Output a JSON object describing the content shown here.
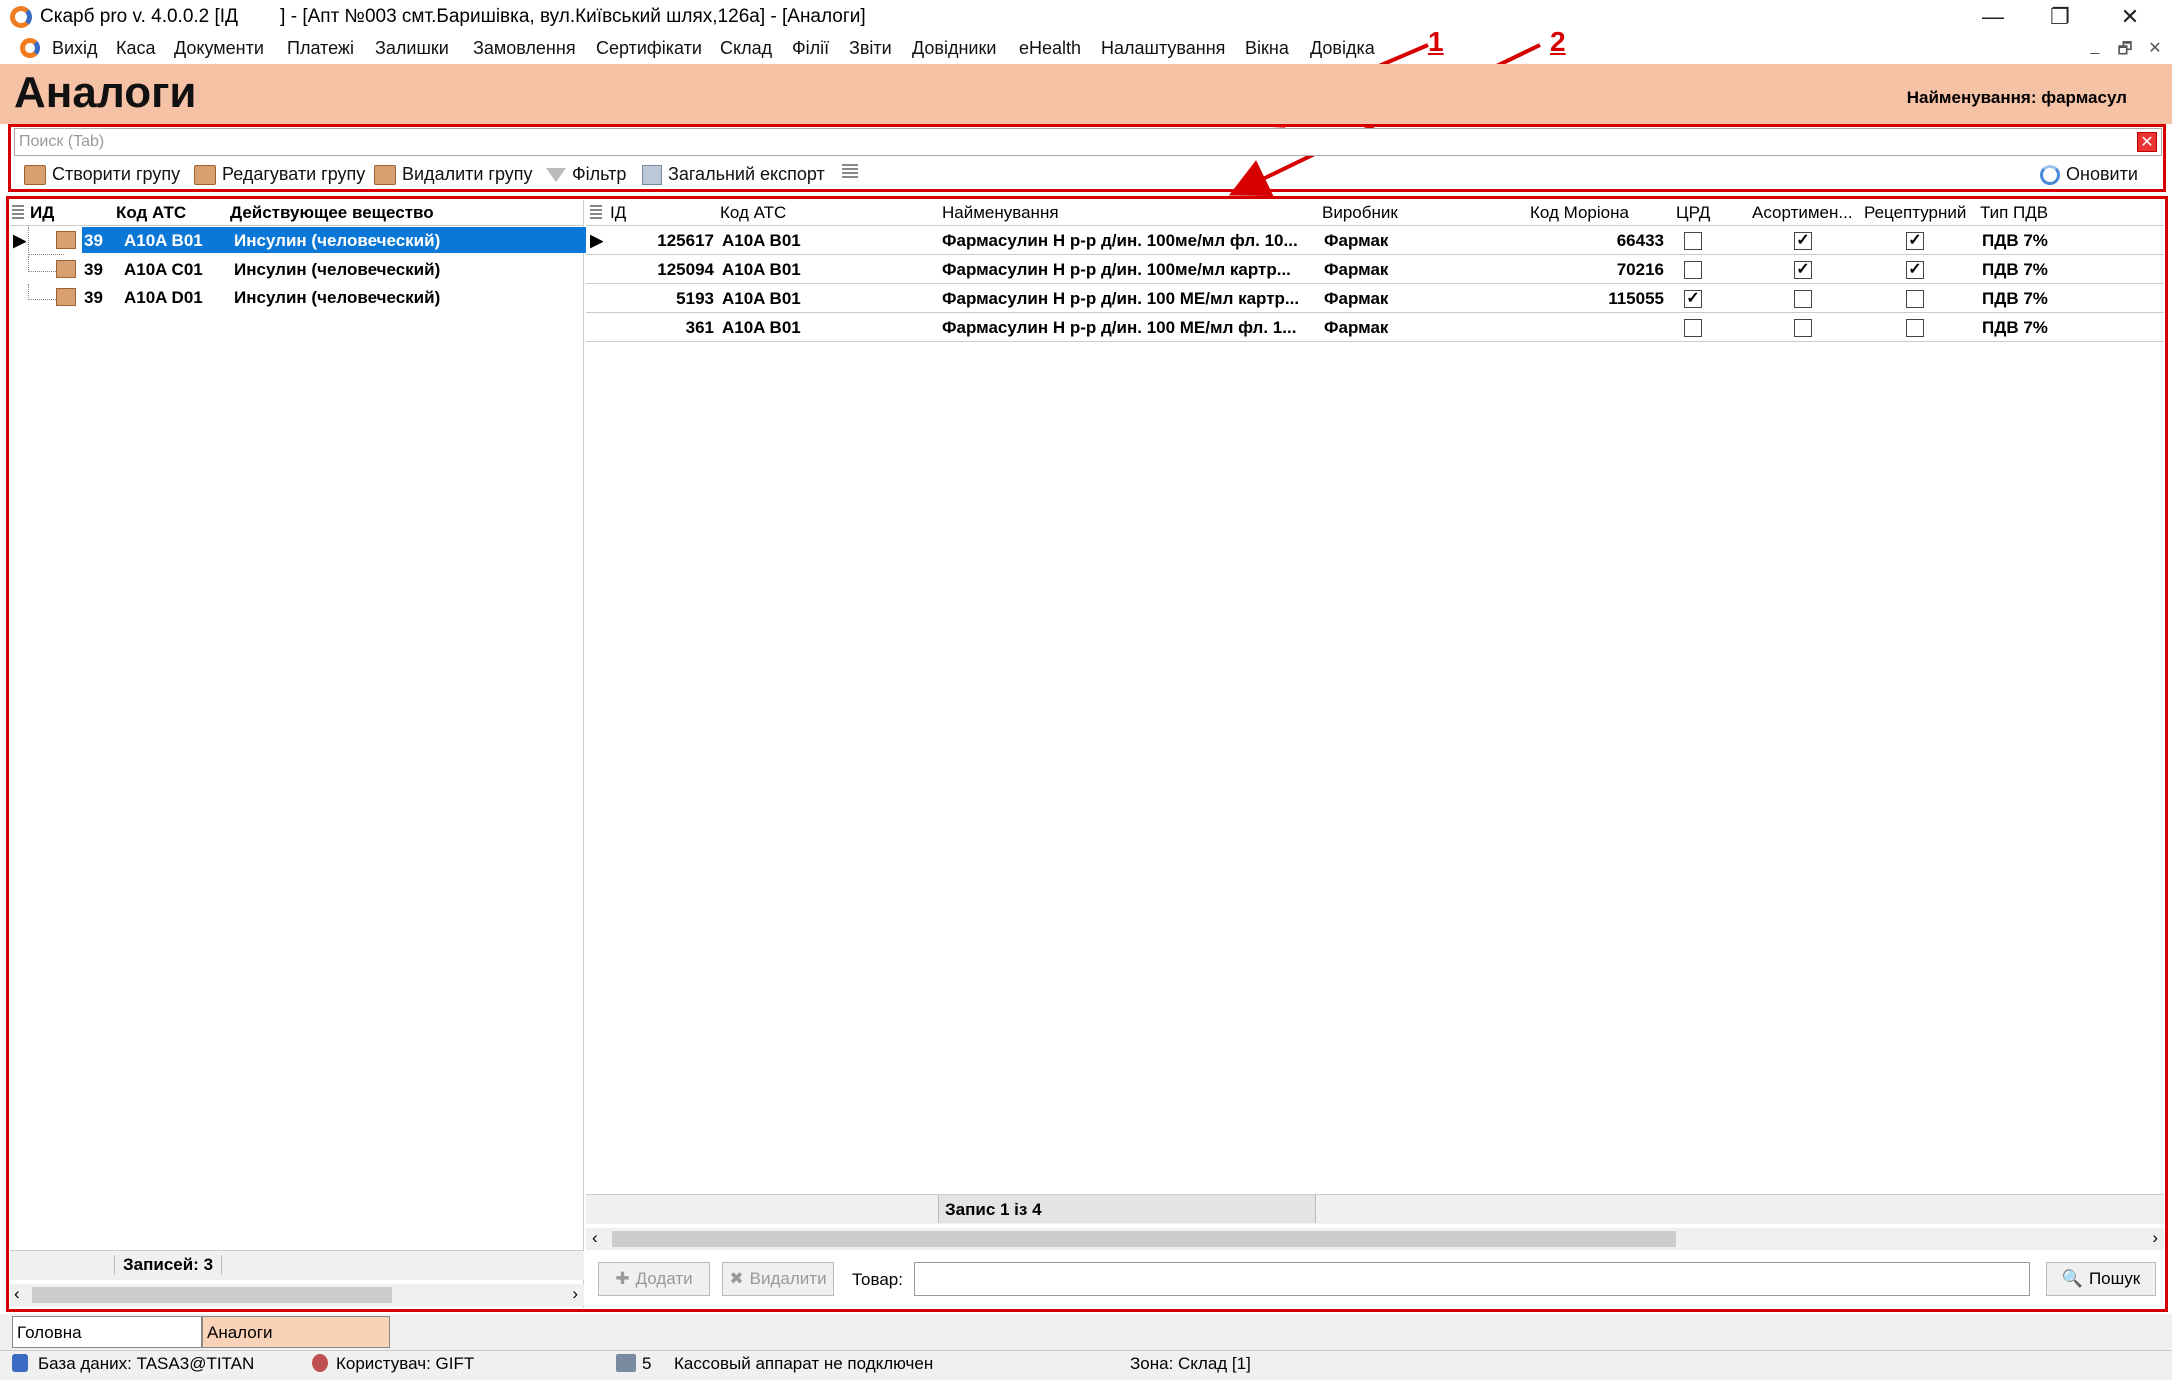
{
  "window": {
    "title": "Скарб pro v. 4.0.0.2 [ІД        ] - [Апт №003 смт.Баришівка, вул.Київський шлях,126а] - [Аналоги]",
    "min": "—",
    "restore": "❐",
    "close": "✕"
  },
  "menu": [
    "Вихід",
    "Каса",
    "Документи",
    "Платежі",
    "Залишки",
    "Замовлення",
    "Сертифікати",
    "Склад",
    "Філії",
    "Звіти",
    "Довідники",
    "eHealth",
    "Налаштування",
    "Вікна",
    "Довідка"
  ],
  "mdi_controls": [
    "_",
    "🗗",
    "✕"
  ],
  "page": {
    "title": "Аналоги",
    "filter_info": "Найменування: фармасул"
  },
  "search": {
    "placeholder": "Поиск (Tab)",
    "value": ""
  },
  "toolbar": {
    "create_group": "Створити групу",
    "edit_group": "Редагувати групу",
    "delete_group": "Видалити групу",
    "filter": "Фільтр",
    "export": "Загальний експорт",
    "refresh": "Оновити"
  },
  "left_grid": {
    "columns": [
      "ИД",
      "Код АТС",
      "Действующее вещество"
    ],
    "rows": [
      {
        "id": "39",
        "atc": "A10A B01",
        "substance": "Инсулин (человеческий)"
      },
      {
        "id": "39",
        "atc": "A10A C01",
        "substance": "Инсулин (человеческий)"
      },
      {
        "id": "39",
        "atc": "A10A D01",
        "substance": "Инсулин (человеческий)"
      }
    ],
    "footer": "Записей: 3"
  },
  "right_grid": {
    "columns": [
      "ІД",
      "Код АТС",
      "Найменування",
      "Виробник",
      "Код Моріона",
      "ЦРД",
      "Асортимен...",
      "Рецептурний",
      "Тип ПДВ"
    ],
    "rows": [
      {
        "id": "125617",
        "atc": "A10A B01",
        "name": "Фармасулин Н р-р д/ин. 100ме/мл фл. 10...",
        "maker": "Фармак",
        "morion": "66433",
        "crd": false,
        "assort": true,
        "recipe": true,
        "vat": "ПДВ 7%"
      },
      {
        "id": "125094",
        "atc": "A10A B01",
        "name": "Фармасулин Н р-р д/ин. 100ме/мл  картр...",
        "maker": "Фармак",
        "morion": "70216",
        "crd": false,
        "assort": true,
        "recipe": true,
        "vat": "ПДВ 7%"
      },
      {
        "id": "5193",
        "atc": "A10A B01",
        "name": "Фармасулин Н р-р д/ин. 100 МЕ/мл картр...",
        "maker": "Фармак",
        "morion": "115055",
        "crd": true,
        "assort": false,
        "recipe": false,
        "vat": "ПДВ 7%"
      },
      {
        "id": "361",
        "atc": "A10A B01",
        "name": "Фармасулин Н р-р д/ин. 100 МЕ/мл фл. 1...",
        "maker": "Фармак",
        "morion": "",
        "crd": false,
        "assort": false,
        "recipe": false,
        "vat": "ПДВ 7%"
      }
    ],
    "footer": "Запис 1 із 4"
  },
  "bottom_actions": {
    "add": "Додати",
    "delete": "Видалити",
    "product_label": "Товар:",
    "product_value": "",
    "search": "Пошук"
  },
  "tabs": [
    "Головна",
    "Аналоги"
  ],
  "status": {
    "db": "База даних: TASA3@TITAN",
    "user": "Користувач: GIFT",
    "count": "5",
    "cash": "Кассовый аппарат не подключен",
    "zone": "Зона: Склад [1]"
  },
  "annotations": [
    "1",
    "2"
  ],
  "colors": {
    "header_bg": "#f6c2a6",
    "annotation": "#d60000",
    "selection": "#0b78d7",
    "active_tab": "#f9d2b8"
  }
}
